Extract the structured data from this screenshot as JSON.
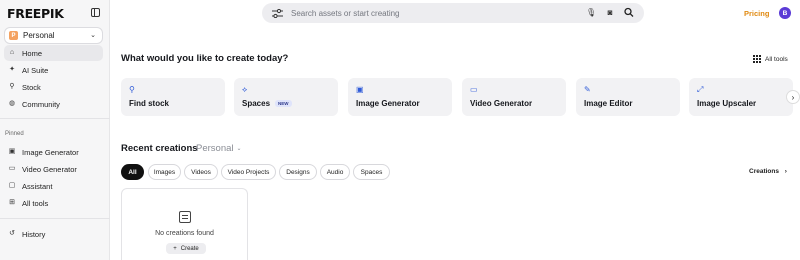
{
  "brand": {
    "logo": "FREEPIK"
  },
  "sidebar": {
    "workspace": {
      "badge": "P",
      "label": "Personal"
    },
    "items": [
      {
        "label": "Home",
        "icon": "home-icon"
      },
      {
        "label": "AI Suite",
        "icon": "sparkle-icon"
      },
      {
        "label": "Stock",
        "icon": "search-icon"
      },
      {
        "label": "Community",
        "icon": "globe-icon"
      }
    ],
    "pinned_label": "Pinned",
    "pinned": [
      {
        "label": "Image Generator",
        "icon": "image-icon"
      },
      {
        "label": "Video Generator",
        "icon": "video-icon"
      },
      {
        "label": "Assistant",
        "icon": "chat-icon"
      },
      {
        "label": "All tools",
        "icon": "grid-icon"
      }
    ],
    "history": {
      "label": "History",
      "icon": "history-icon"
    }
  },
  "topbar": {
    "search_placeholder": "Search assets or start creating",
    "pricing": "Pricing",
    "avatar_initial": "B"
  },
  "create": {
    "heading": "What would you like to create today?",
    "all_tools": "All tools",
    "cards": [
      {
        "label": "Find stock",
        "icon": "search-icon"
      },
      {
        "label": "Spaces",
        "badge": "NEW",
        "icon": "spaces-icon"
      },
      {
        "label": "Image Generator",
        "icon": "image-icon"
      },
      {
        "label": "Video Generator",
        "icon": "video-icon"
      },
      {
        "label": "Image Editor",
        "icon": "edit-icon"
      },
      {
        "label": "Image Upscaler",
        "icon": "upscale-icon"
      }
    ]
  },
  "recent": {
    "heading": "Recent creations",
    "workspace": "Personal",
    "filters": [
      "All",
      "Images",
      "Videos",
      "Video Projects",
      "Designs",
      "Audio",
      "Spaces"
    ],
    "active_filter": "All",
    "creations_link": "Creations",
    "empty_text": "No creations found",
    "create_button": "Create"
  }
}
